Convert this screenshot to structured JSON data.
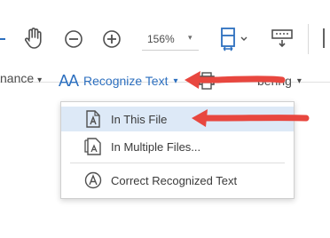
{
  "toolbar": {
    "zoom_value": "156%",
    "zoom_caret": "▾",
    "icons": [
      "hand-tool-icon",
      "zoom-out-icon",
      "zoom-in-icon",
      "fit-page-icon",
      "keyboard-icon"
    ]
  },
  "menubar": {
    "left_partial_label": "nance",
    "left_caret": "▾",
    "recognize_aa": "AA",
    "recognize_label": "Recognize Text",
    "recognize_caret": "▾",
    "right_partial_label": "bering",
    "right_caret": "▾"
  },
  "dropdown": {
    "items": [
      {
        "label": "In This File",
        "icon": "page-text-icon",
        "highlighted": true
      },
      {
        "label": "In Multiple Files...",
        "icon": "multi-page-text-icon",
        "highlighted": false
      },
      {
        "label": "Correct Recognized Text",
        "icon": "correct-text-icon",
        "highlighted": false
      }
    ]
  },
  "annotations": {
    "arrow_color": "#e8473f"
  },
  "colors": {
    "accent_blue": "#2c6fbf",
    "highlight": "#dde9f7",
    "icon_gray": "#505050"
  }
}
